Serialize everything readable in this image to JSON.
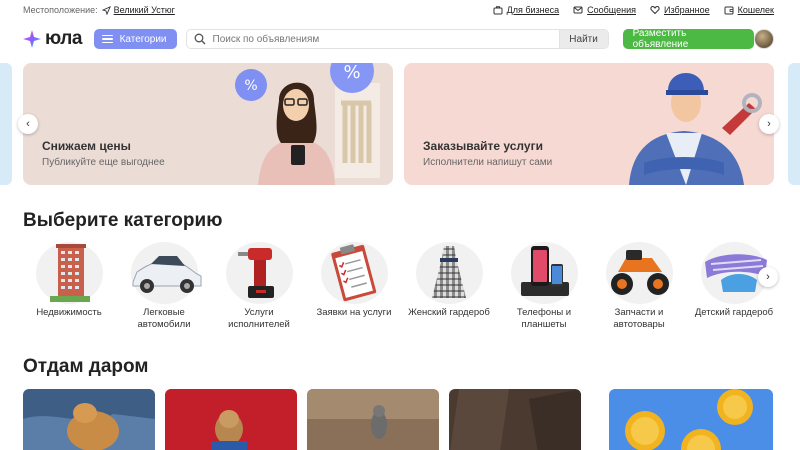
{
  "topbar": {
    "location_label": "Местоположение:",
    "location_value": "Великий Устюг",
    "links": [
      {
        "label": "Для бизнеса",
        "icon": "briefcase-icon"
      },
      {
        "label": "Сообщения",
        "icon": "envelope-icon"
      },
      {
        "label": "Избранное",
        "icon": "heart-icon"
      },
      {
        "label": "Кошелек",
        "icon": "wallet-icon"
      }
    ]
  },
  "header": {
    "logo_text": "юла",
    "categories_label": "Категории",
    "search_placeholder": "Поиск по объявлениям",
    "search_button": "Найти",
    "post_button": "Разместить объявление"
  },
  "banners": [
    {
      "title": "Снижаем цены",
      "subtitle": "Публикуйте еще выгоднее"
    },
    {
      "title": "Заказывайте услуги",
      "subtitle": "Исполнители напишут сами"
    }
  ],
  "categories_section": {
    "title": "Выберите категорию",
    "items": [
      {
        "label": "Недвижимость",
        "icon": "building-icon"
      },
      {
        "label": "Легковые автомобили",
        "icon": "car-icon"
      },
      {
        "label": "Услуги исполнителей",
        "icon": "drill-icon"
      },
      {
        "label": "Заявки на услуги",
        "icon": "clipboard-icon"
      },
      {
        "label": "Женский гардероб",
        "icon": "dress-icon"
      },
      {
        "label": "Телефоны и планшеты",
        "icon": "phone-icon"
      },
      {
        "label": "Запчасти и автотовары",
        "icon": "atv-icon"
      },
      {
        "label": "Детский гардероб",
        "icon": "sled-icon"
      }
    ]
  },
  "free_section": {
    "title": "Отдам даром"
  },
  "colors": {
    "accent": "#7f8ff2",
    "post_button": "#4cb944",
    "banner1": "#ecdcd6",
    "banner2": "#f6d9d3"
  }
}
